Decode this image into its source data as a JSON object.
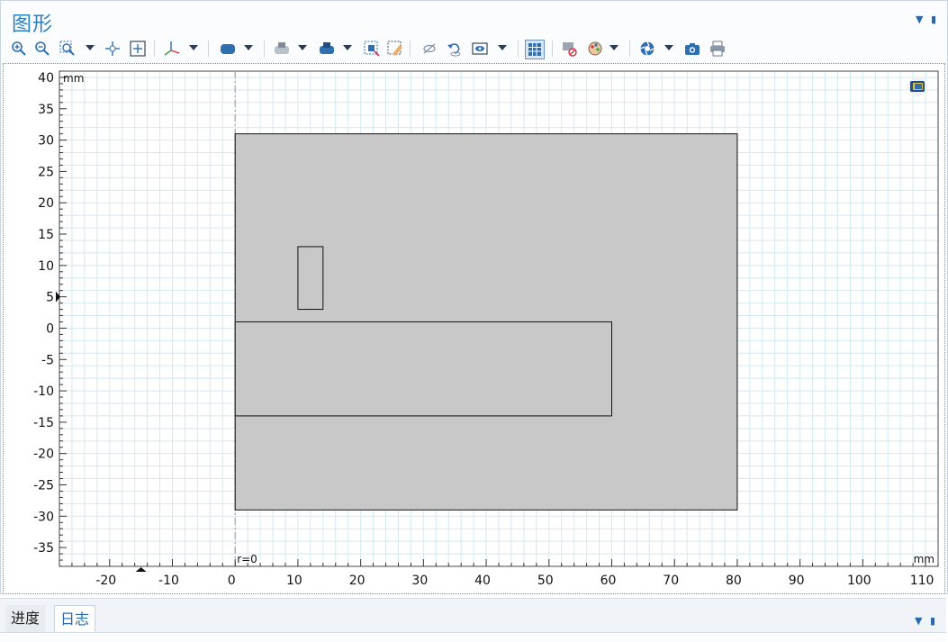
{
  "window": {
    "title": "图形"
  },
  "toolbar": {
    "icons": [
      "zoom-in-icon",
      "zoom-out-icon",
      "zoom-box-icon",
      "chevron-down-icon",
      "pan-icon",
      "zoom-extents-icon",
      "axes-icon",
      "chevron-down-icon",
      "select-objects-icon",
      "chevron-down-icon",
      "transparency-icon",
      "chevron-down-icon",
      "select-boundaries-icon",
      "chevron-down-icon",
      "select-box-icon",
      "deselect-icon",
      "hide-icon",
      "reset-hiding-icon",
      "view-icon",
      "chevron-down-icon",
      "grid-icon",
      "clear-selection-icon",
      "colors-icon",
      "chevron-down-icon",
      "scene-light-icon",
      "chevron-down-icon",
      "image-snapshot-icon",
      "print-icon"
    ]
  },
  "plot": {
    "x_unit": "mm",
    "y_unit": "mm",
    "axis_label": "r=0",
    "x_ticks": [
      "-20",
      "-10",
      "0",
      "10",
      "20",
      "30",
      "40",
      "50",
      "60",
      "70",
      "80",
      "90",
      "100",
      "110"
    ],
    "y_ticks": [
      "40",
      "35",
      "30",
      "25",
      "20",
      "15",
      "10",
      "5",
      "0",
      "-5",
      "-10",
      "-15",
      "-20",
      "-25",
      "-30",
      "-35"
    ],
    "x_range": [
      -28,
      112
    ],
    "y_range": [
      -38,
      41
    ],
    "shapes": [
      {
        "name": "outer-domain-rect",
        "x": [
          0,
          80
        ],
        "y": [
          -29,
          31
        ]
      },
      {
        "name": "inner-horizontal-rect",
        "x": [
          0,
          60
        ],
        "y": [
          -14,
          1
        ]
      },
      {
        "name": "small-vertical-rect",
        "x": [
          10,
          14
        ],
        "y": [
          3,
          13
        ]
      }
    ],
    "colors": {
      "fill": "#c8c8c8",
      "grid": "#d4e8f2",
      "axis_dash": "#9aa6b2"
    }
  },
  "bottom_tabs": [
    {
      "label": "进度"
    },
    {
      "label": "日志"
    }
  ]
}
